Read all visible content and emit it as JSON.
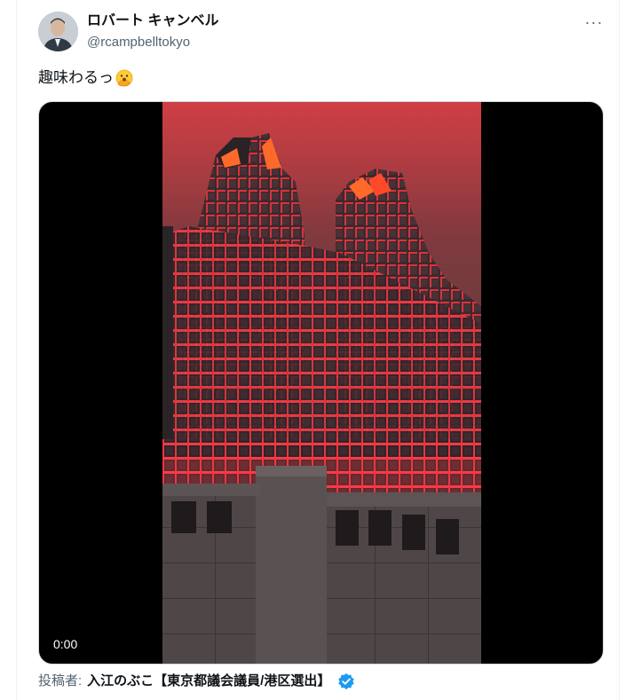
{
  "author": {
    "display_name": "ロバート キャンベル",
    "handle": "@rcampbelltokyo",
    "avatar_icon": "user-avatar"
  },
  "tweet": {
    "text": "趣味わるっ",
    "emoji": "face-with-open-eyes-and-hand-over-mouth-emoji"
  },
  "video": {
    "timestamp": "0:00"
  },
  "quoted_author": {
    "label": "投稿者:",
    "name": "入江のぶこ【東京都議会議員/港区選出】",
    "badge": "verified-badge-icon"
  },
  "menu": {
    "more_label": "···"
  },
  "colors": {
    "text_primary": "#0f1419",
    "text_secondary": "#536471",
    "verified_blue": "#1d9bf0",
    "building_red": "#e0303a"
  }
}
